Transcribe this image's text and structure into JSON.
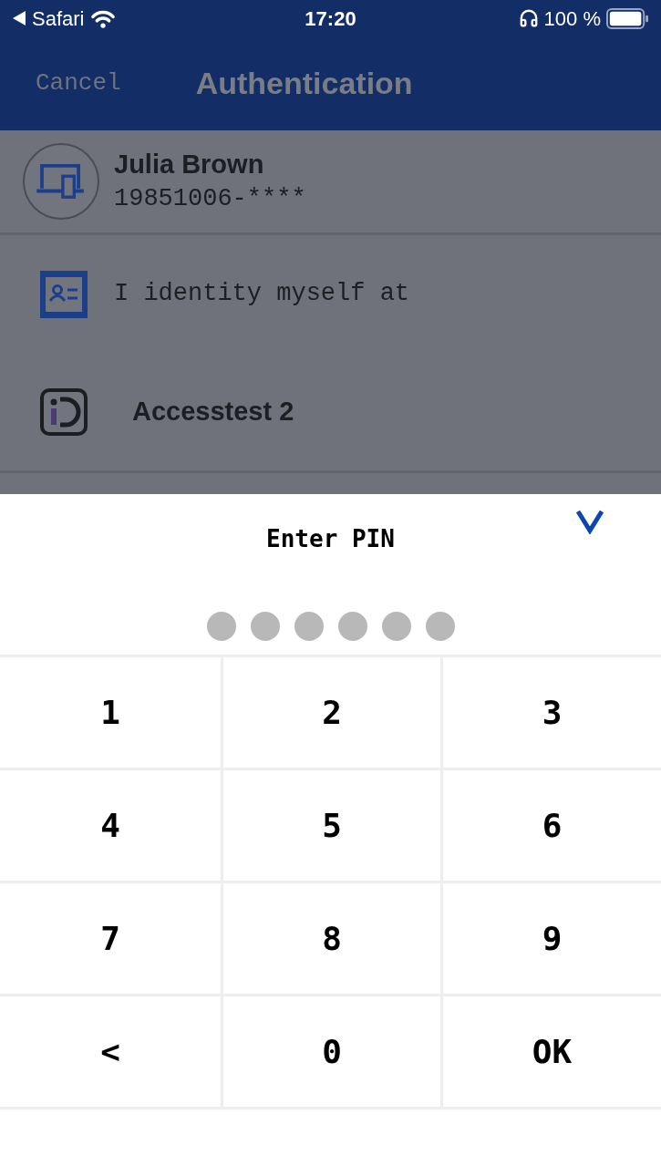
{
  "status_bar": {
    "back_app": "Safari",
    "time": "17:20",
    "battery": "100 %"
  },
  "nav_bar": {
    "cancel": "Cancel",
    "title": "Authentication"
  },
  "identity": {
    "name": "Julia Brown",
    "personal_number": "19851006-****"
  },
  "info_rows": [
    {
      "kind": "id-card",
      "text": "I identity myself at"
    },
    {
      "kind": "id-logo",
      "text": "Accesstest 2"
    }
  ],
  "pin_sheet": {
    "title": "Enter PIN",
    "pin_dots": [
      {
        "filled": false
      },
      {
        "filled": false
      },
      {
        "filled": false
      },
      {
        "filled": false
      },
      {
        "filled": false
      },
      {
        "filled": false
      }
    ],
    "keys": [
      "1",
      "2",
      "3",
      "4",
      "5",
      "6",
      "7",
      "8",
      "9",
      "<",
      "0",
      "OK"
    ]
  }
}
